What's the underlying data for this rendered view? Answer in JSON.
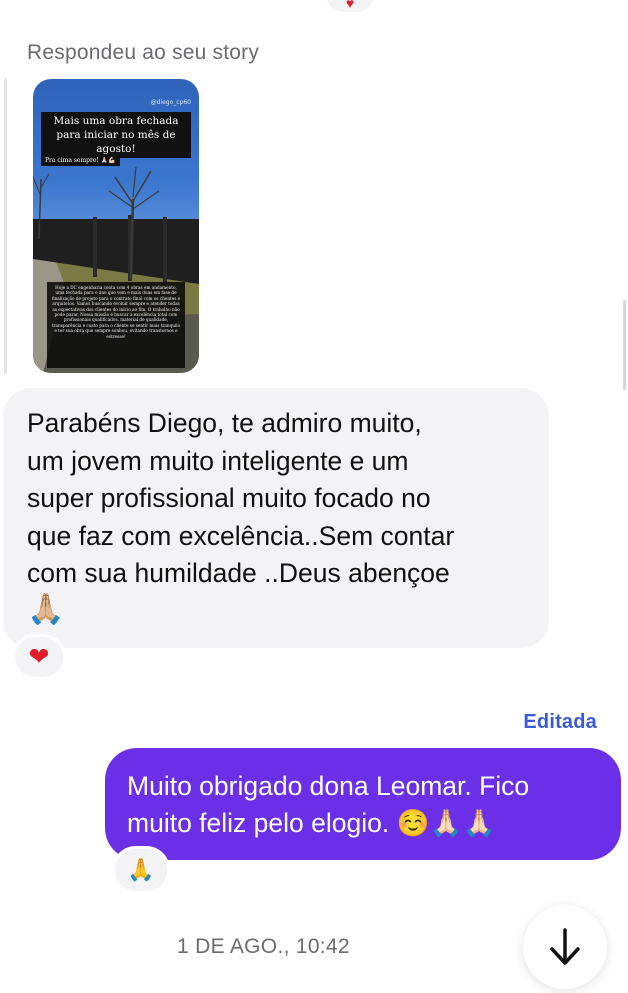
{
  "top_reaction": {
    "emoji": "heart-icon",
    "color": "#e0202e"
  },
  "story": {
    "caption": "Respondeu ao seu story",
    "handle": "@diego_cp60",
    "title": "Mais uma obra fechada para iniciar no mês de agosto!",
    "subtitle": "Pra cima sempre! 🙏🏻💪🏻",
    "body": "Hoje a DC engenharia conta com 4 obras em andamento, uma fechada para o ano que vem e mais duas em fase de finalização de projeto para o contrato final com os clientes e arquitetos. Vamos buscando evoluir sempre e atender todas as expectativas dos clientes do início ao fim. O trabalho não pode parar. Nossa missão é buscar a excelência total com profissionais qualificados, material de qualidade, transparência e custo para o cliente se sentir mais tranquilo e ter sua obra que sempre sonhou, evitando transtornos e estresse!"
  },
  "incoming_message": {
    "text": "Parabéns Diego,  te admiro  muito,\num jovem muito  inteligente e um\nsuper profissional  muito focado no\nque faz com excelência..Sem contar\ncom sua humildade ..Deus abençoe",
    "emoji": "🙏🏼",
    "reaction": "heart-icon"
  },
  "outgoing_message": {
    "edited_label": "Editada",
    "text": "Muito obrigado dona Leomar. Fico\nmuito feliz pelo elogio. ☺️🙏🏻🙏🏻",
    "reaction": "🙏"
  },
  "timestamp": "1 DE AGO., 10:42",
  "scroll_button": {
    "icon": "arrow-down-icon"
  },
  "colors": {
    "outgoing_bubble": "#6b2fe8",
    "incoming_bubble": "#f3f3f5",
    "edited_label": "#3a5bd8",
    "meta_text": "#6c6c70"
  }
}
